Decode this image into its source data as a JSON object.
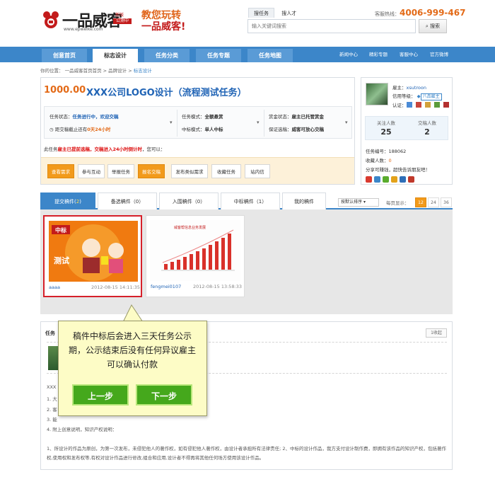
{
  "header": {
    "logo_text": "一品威客",
    "logo_url": "www.epweike.com",
    "logo_badge_top": "新版",
    "logo_badge": "公测中",
    "slogan_line1": "教您玩转",
    "slogan_line2": "一品威客!",
    "search_tabs": [
      "搜任务",
      "搜人才"
    ],
    "search_placeholder": "输入关键词搜索",
    "search_button": "搜索",
    "hotline_label": "客服热线：",
    "hotline_number": "4006-999-467"
  },
  "nav": {
    "items": [
      "创意首页",
      "标志设计",
      "任务分类",
      "任务专题",
      "任务地图"
    ],
    "right_links": [
      "新闻中心",
      "精彩专题",
      "客服中心",
      "官方微博"
    ]
  },
  "breadcrumb": {
    "prefix": "你的位置：",
    "items": [
      "一品威客首页首页",
      "品牌设计",
      "标志设计"
    ]
  },
  "task": {
    "price": "1000.00",
    "title": "XXX公司LOGO设计（流程测试任务）",
    "status_label": "任务状态：",
    "status_value": "任务进行中，欢迎交稿",
    "deadline_label": "距交稿截止还有",
    "deadline_value": "0天24小时",
    "mode_label": "任务模式：",
    "mode_value": "全额悬赏",
    "bid_label": "中标模式：",
    "bid_value": "单人中标",
    "bounty_label": "赏金状态：",
    "bounty_value": "雇主已托管赏金",
    "guarantee_label": "保证选稿：",
    "guarantee_value": "威客可放心交稿",
    "notice_prefix": "此任务",
    "notice_red": "雇主已提前选稿，交稿进入24小时倒计时",
    "notice_suffix": "，您可以："
  },
  "actions": [
    "查看需求",
    "参与互动",
    "举报任务",
    "报名交稿",
    "发布类似需求",
    "收藏任务",
    "站内信"
  ],
  "employer": {
    "name_label": "雇主：",
    "name": "xsutroon",
    "credit_label": "信用等级：",
    "credit_badge": "八品雇主",
    "cert_label": "认证：",
    "stat_labels": [
      "关注人数",
      "交稿人数"
    ],
    "stat_values": [
      "25",
      "2"
    ],
    "task_no_label": "任务编号：",
    "task_no": "188062",
    "fav_label": "收藏人数：",
    "fav_count": "0",
    "share_text": "分享可赚钱，超快告诉朋友吧！"
  },
  "tabs": {
    "submit_label": "提交稿件",
    "submit_count": "2",
    "items": [
      "备选稿件（0）",
      "入围稿件（0）",
      "中标稿件（1）",
      "我的稿件"
    ],
    "sort_label": "按默认排序",
    "per_page_label": "每页显示：",
    "pages": [
      "12",
      "24",
      "36"
    ]
  },
  "submissions": [
    {
      "user": "aaaa",
      "time": "2012-08-15 14:11:35",
      "thumb_text": "中标",
      "thumb_sub": "测试"
    },
    {
      "user": "fengmei0107",
      "time": "2012-08-15 13:58:33",
      "thumb_text": "威客帮信息业务发展"
    }
  ],
  "lower": {
    "title": "任务",
    "collapse": "1收起",
    "lines": [
      "XXX",
      "1. 大",
      "2. 客",
      "3. 能",
      "4. 附上创意说明，知识产权说明："
    ],
    "terms": "1、所设计的作品为原创，为第一次发布，未侵犯他人的著作权，如有侵犯他人著作权，由设计者承担所有法律责任; 2、中标的设计作品，我方支付设计制作费，即拥有该作品的知识产权，包括著作权,使用权和发布权等,有权对设计作品进行修改,组合和应用,设计者不得再将其他任何场方使用该设计作品。"
  },
  "tooltip": {
    "text": "稿件中标后会进入三天任务公示期，公示结束后没有任何异议雇主可以确认付款",
    "prev": "上一步",
    "next": "下一步"
  },
  "colors": {
    "brand_blue": "#3c86c9",
    "accent_orange": "#e36a17",
    "tip_green": "#45a81c"
  }
}
